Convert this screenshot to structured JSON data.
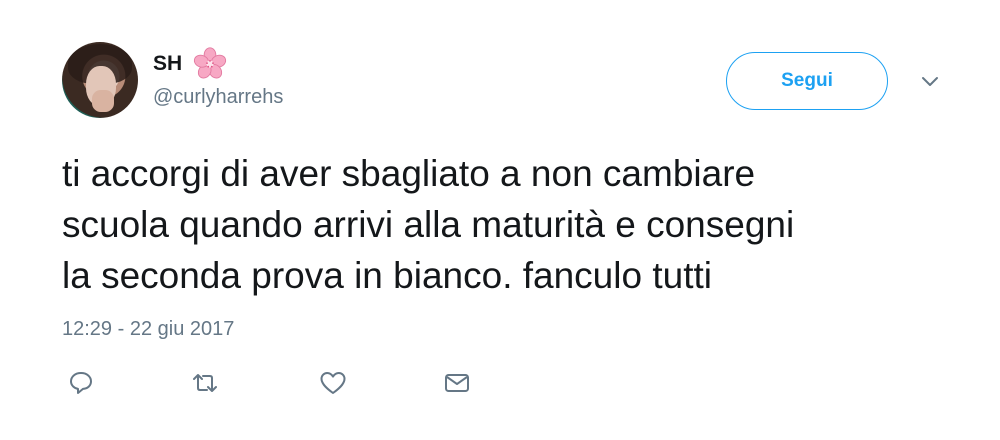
{
  "tweet": {
    "display_name": "SH",
    "handle": "@curlyharrehs",
    "follow_label": "Segui",
    "text_lines": [
      "ti accorgi di aver sbagliato a non cambiare",
      "scuola quando arrivi alla maturità e consegni",
      "la seconda prova in bianco. fanculo tutti"
    ],
    "timestamp": "12:29 - 22 giu 2017",
    "icons": {
      "name_emoji": "cherry-blossom-icon",
      "menu": "chevron-down-icon",
      "actions": [
        "reply-icon",
        "retweet-icon",
        "like-icon",
        "direct-message-icon"
      ]
    },
    "colors": {
      "accent": "#1da1f2",
      "text": "#14171a",
      "secondary": "#657786",
      "flower": "#f7a8c4"
    }
  }
}
